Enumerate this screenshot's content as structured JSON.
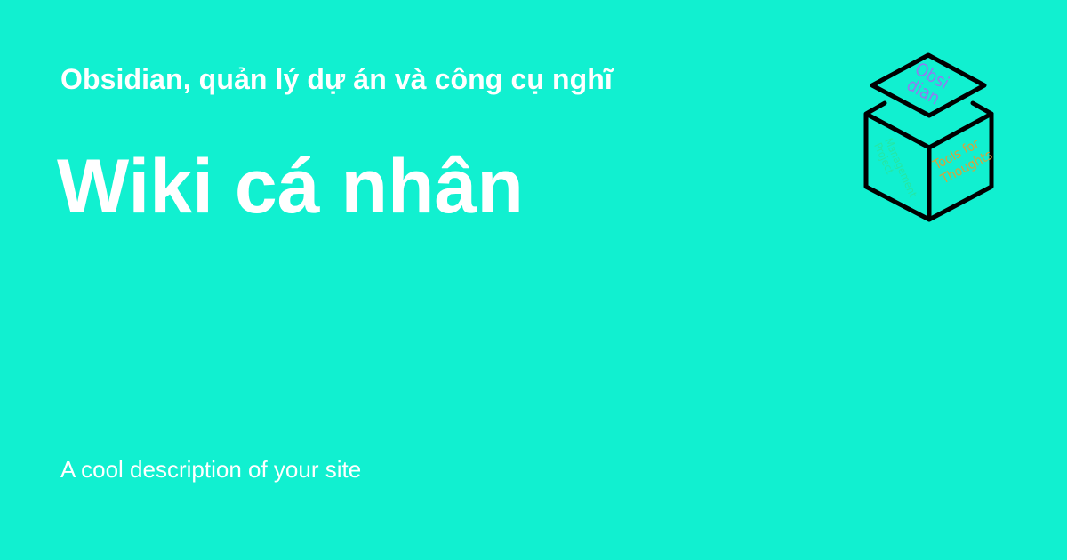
{
  "card": {
    "subtitle": "Obsidian, quản lý dự án và công cụ nghĩ",
    "title": "Wiki cá nhân",
    "description": "A cool description of your site"
  },
  "logo": {
    "icon": "obsidian-cube-logo-icon",
    "top_face_lines": [
      "Obsi",
      "dian"
    ],
    "left_face_lines": [
      "Project",
      "Management"
    ],
    "right_face_lines": [
      "Tools for",
      "Thoughts"
    ],
    "colors": {
      "background": "#11f0d0",
      "outline": "#000000",
      "top_text": "#8f7cf0",
      "left_text": "#26e6a3",
      "right_text": "#d9a13a"
    }
  }
}
